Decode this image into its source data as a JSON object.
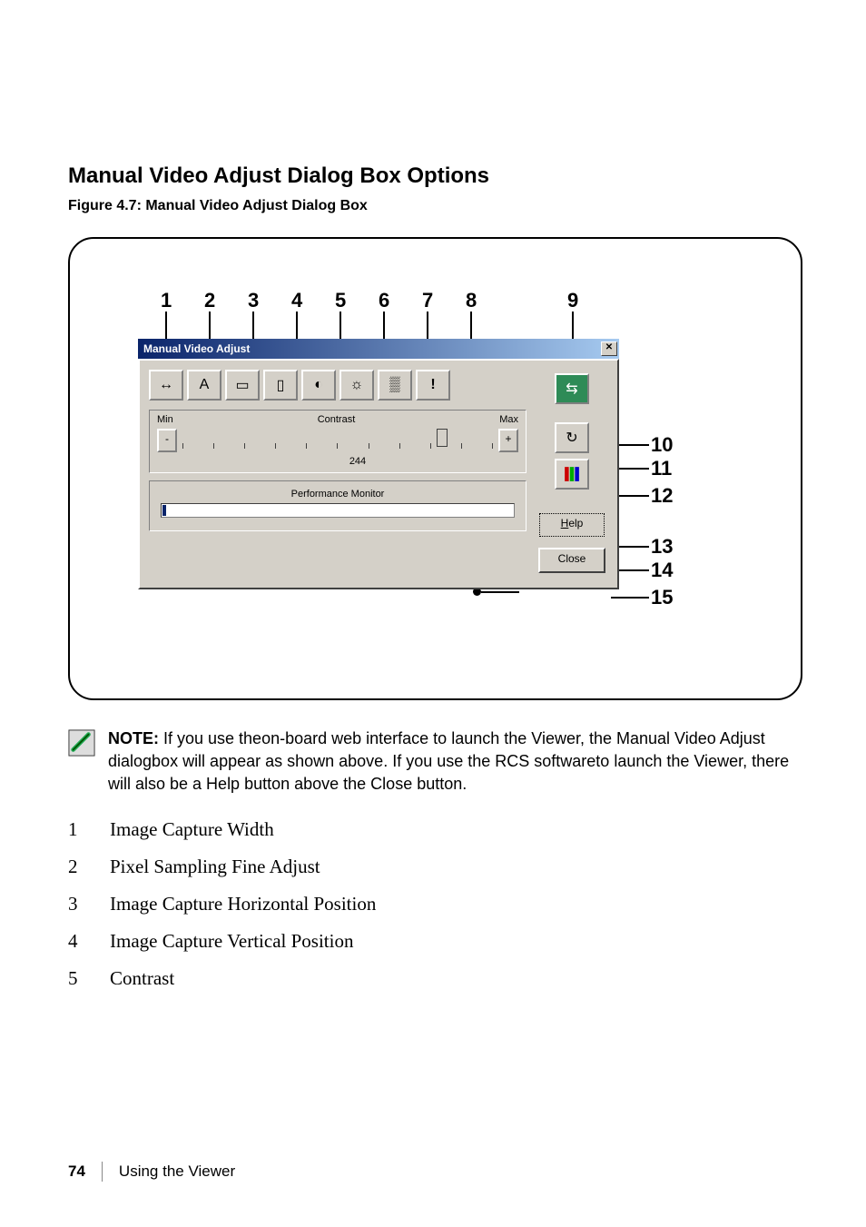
{
  "section_heading": "Manual Video Adjust Dialog Box Options",
  "figure_caption": "Figure 4.7: Manual Video Adjust Dialog Box",
  "dialog": {
    "title": "Manual Video Adjust",
    "close_glyph": "✕",
    "slider": {
      "min_label": "Min",
      "max_label": "Max",
      "name": "Contrast",
      "value": "244",
      "minus": "-",
      "plus": "+"
    },
    "perf_label": "Performance Monitor",
    "buttons": {
      "help": "Help",
      "close": "Close"
    }
  },
  "callouts": {
    "top": {
      "c1": "1",
      "c2": "2",
      "c3": "3",
      "c4": "4",
      "c5": "5",
      "c6": "6",
      "c7": "7",
      "c8": "8",
      "c9": "9"
    },
    "right": {
      "c10": "10",
      "c11": "11",
      "c12": "12",
      "c13": "13",
      "c14": "14",
      "c15": "15"
    }
  },
  "note": {
    "label": "NOTE:",
    "text": " If you use theon-board web interface to launch the Viewer, the Manual Video Adjust dialogbox will appear as shown above. If you use the RCS softwareto launch the Viewer, there will also be a Help button above the Close button."
  },
  "legend": [
    {
      "n": "1",
      "text": "Image Capture Width"
    },
    {
      "n": "2",
      "text": "Pixel Sampling Fine Adjust"
    },
    {
      "n": "3",
      "text": "Image Capture Horizontal Position"
    },
    {
      "n": "4",
      "text": "Image Capture Vertical Position"
    },
    {
      "n": "5",
      "text": "Contrast"
    }
  ],
  "footer": {
    "page": "74",
    "chapter": "Using the Viewer"
  }
}
